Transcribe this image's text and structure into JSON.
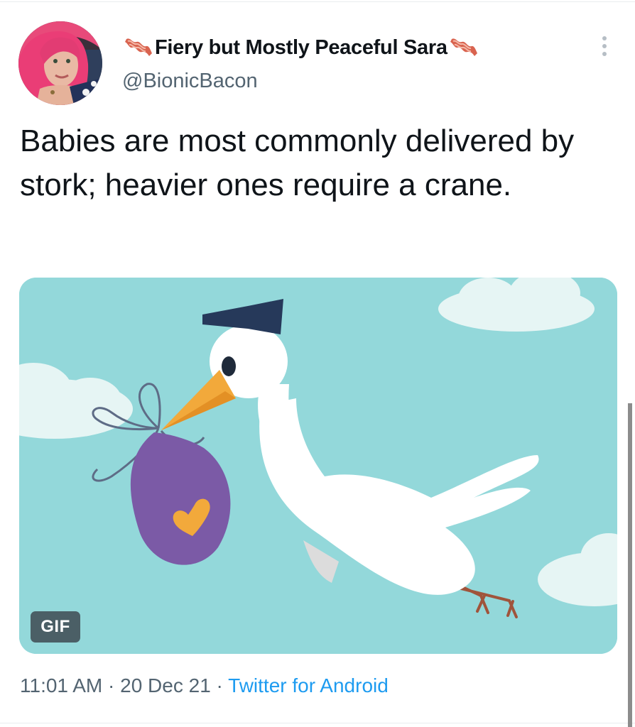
{
  "tweet": {
    "display_name": "Fiery but Mostly Peaceful Sara",
    "handle": "@BionicBacon",
    "text": "Babies are most commonly delivered by stork; heavier ones require a crane.",
    "media": {
      "badge": "GIF"
    },
    "meta": {
      "time": "11:01 AM",
      "separator": " · ",
      "date": "20 Dec 21",
      "source": "Twitter for Android"
    }
  },
  "icons": {
    "name_emoji": "bacon-icon",
    "more": "more-vertical-icon"
  },
  "colors": {
    "link": "#1d9bf0",
    "secondary_text": "#536471",
    "sky": "#93d8da",
    "bundle": "#7b5aa6",
    "heart": "#f2a93b",
    "beak": "#f2a93b"
  }
}
